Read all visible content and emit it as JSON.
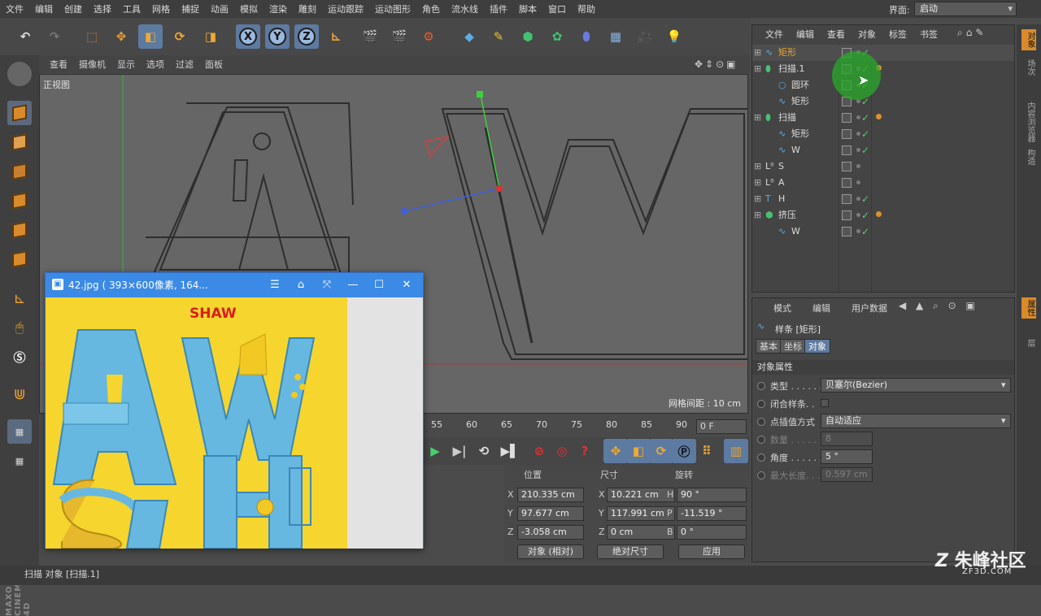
{
  "menu": [
    "文件",
    "编辑",
    "创建",
    "选择",
    "工具",
    "网格",
    "捕捉",
    "动画",
    "模拟",
    "渲染",
    "雕刻",
    "运动跟踪",
    "运动图形",
    "角色",
    "流水线",
    "插件",
    "脚本",
    "窗口",
    "帮助"
  ],
  "interface": {
    "label": "界面:",
    "value": "启动"
  },
  "viewport": {
    "menu": [
      "查看",
      "摄像机",
      "显示",
      "选项",
      "过滤",
      "面板"
    ],
    "label": "正视图",
    "grid_spacing": "网格间距 : 10 cm"
  },
  "timeline": {
    "ticks": [
      "55",
      "60",
      "65",
      "70",
      "75",
      "80",
      "85",
      "90"
    ],
    "current_frame": "0 F"
  },
  "coords": {
    "headers": {
      "position": "位置",
      "size": "尺寸",
      "rotation": "旋转"
    },
    "rows": [
      {
        "axis": "X",
        "pos": "210.335 cm",
        "size_axis": "X",
        "size": "10.221 cm",
        "rot_axis": "H",
        "rot": "90 °"
      },
      {
        "axis": "Y",
        "pos": "97.677 cm",
        "size_axis": "Y",
        "size": "117.991 cm",
        "rot_axis": "P",
        "rot": "-11.519 °"
      },
      {
        "axis": "Z",
        "pos": "-3.058 cm",
        "size_axis": "Z",
        "size": "0 cm",
        "rot_axis": "B",
        "rot": "0 °"
      }
    ],
    "mode_object": "对象 (相对)",
    "mode_size": "绝对尺寸",
    "apply": "应用"
  },
  "object_manager": {
    "menu": [
      "文件",
      "编辑",
      "查看",
      "对象",
      "标签",
      "书签"
    ],
    "objects": [
      {
        "name": "矩形",
        "indent": 0,
        "icon": "spline-icon",
        "highlight": true,
        "check": true,
        "tag": false
      },
      {
        "name": "扫描.1",
        "indent": 0,
        "icon": "sweep-icon",
        "check": true,
        "tag": true
      },
      {
        "name": "圆环",
        "indent": 1,
        "icon": "circle-icon",
        "check": true,
        "tag": false
      },
      {
        "name": "矩形",
        "indent": 1,
        "icon": "spline-icon",
        "check": true,
        "tag": false
      },
      {
        "name": "扫描",
        "indent": 0,
        "icon": "sweep-icon",
        "check": true,
        "tag": true
      },
      {
        "name": "矩形",
        "indent": 1,
        "icon": "spline-icon",
        "check": true,
        "tag": false
      },
      {
        "name": "W",
        "indent": 1,
        "icon": "spline-icon",
        "check": true,
        "tag": false
      },
      {
        "name": "S",
        "indent": 0,
        "icon": "null-icon",
        "check": false,
        "tag": false
      },
      {
        "name": "A",
        "indent": 0,
        "icon": "null-icon",
        "check": false,
        "tag": false
      },
      {
        "name": "H",
        "indent": 0,
        "icon": "text-icon",
        "check": true,
        "tag": false
      },
      {
        "name": "挤压",
        "indent": 0,
        "icon": "extrude-icon",
        "check": true,
        "tag": true
      },
      {
        "name": "W",
        "indent": 1,
        "icon": "spline-icon",
        "check": true,
        "tag": false
      }
    ]
  },
  "attributes": {
    "menu": [
      "模式",
      "编辑",
      "用户数据"
    ],
    "object_title": "样条 [矩形]",
    "tabs": [
      "基本",
      "坐标",
      "对象"
    ],
    "section": "对象属性",
    "fields": [
      {
        "label": "类型 . . . . . .",
        "value": "贝塞尔(Bezier)",
        "kind": "select",
        "disabled": false
      },
      {
        "label": "闭合样条. .",
        "value": "",
        "kind": "checkbox",
        "disabled": false
      },
      {
        "label": "点插值方式",
        "value": "自动适应",
        "kind": "select",
        "disabled": false
      },
      {
        "label": "数量 . . . . . .",
        "value": "8",
        "kind": "number",
        "disabled": true
      },
      {
        "label": "角度 . . . . . .",
        "value": "5 °",
        "kind": "number",
        "disabled": false
      },
      {
        "label": "最大长度. . .",
        "value": "0.597 cm",
        "kind": "number",
        "disabled": true
      }
    ]
  },
  "right_tabs": [
    "对象",
    "场次",
    "内容浏览器",
    "构造",
    "属性",
    "层"
  ],
  "status": "扫描 对象 [扫描.1]",
  "viewer": {
    "title": "42.jpg ( 393×600像素, 164...",
    "poster_text": "SHAW"
  },
  "watermark": {
    "main": "朱峰社区",
    "sub": "ZF3D.COM"
  },
  "maxon": "MAXON CINEMA 4D"
}
